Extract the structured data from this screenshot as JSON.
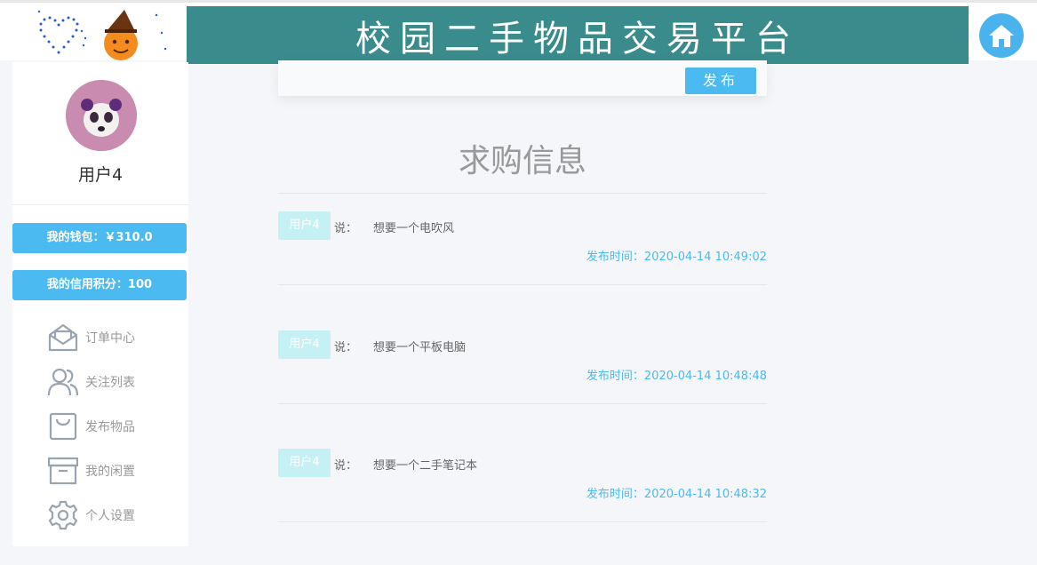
{
  "header": {
    "title": "校园二手物品交易平台",
    "home_icon": "home-icon",
    "banner_color": "#3a8c8c"
  },
  "sidebar": {
    "username": "用户4",
    "wallet_label": "我的钱包：￥310.0",
    "credit_label": "我的信用积分：100",
    "menu": [
      {
        "label": "订单中心",
        "icon": "envelope-open-icon"
      },
      {
        "label": "关注列表",
        "icon": "users-icon"
      },
      {
        "label": "发布物品",
        "icon": "bag-icon"
      },
      {
        "label": "我的闲置",
        "icon": "archive-box-icon"
      },
      {
        "label": "个人设置",
        "icon": "gear-icon"
      }
    ]
  },
  "main": {
    "publish_label": "发布",
    "section_title": "求购信息",
    "posts": [
      {
        "user": "用户4",
        "says": "说：",
        "content": "想要一个电吹风",
        "time": "发布时间：2020-04-14 10:49:02"
      },
      {
        "user": "用户4",
        "says": "说：",
        "content": "想要一个平板电脑",
        "time": "发布时间：2020-04-14 10:48:48"
      },
      {
        "user": "用户4",
        "says": "说：",
        "content": "想要一个二手笔记本",
        "time": "发布时间：2020-04-14 10:48:32"
      }
    ]
  },
  "colors": {
    "accent": "#4bbaf1",
    "tag": "#c5f1f5"
  }
}
